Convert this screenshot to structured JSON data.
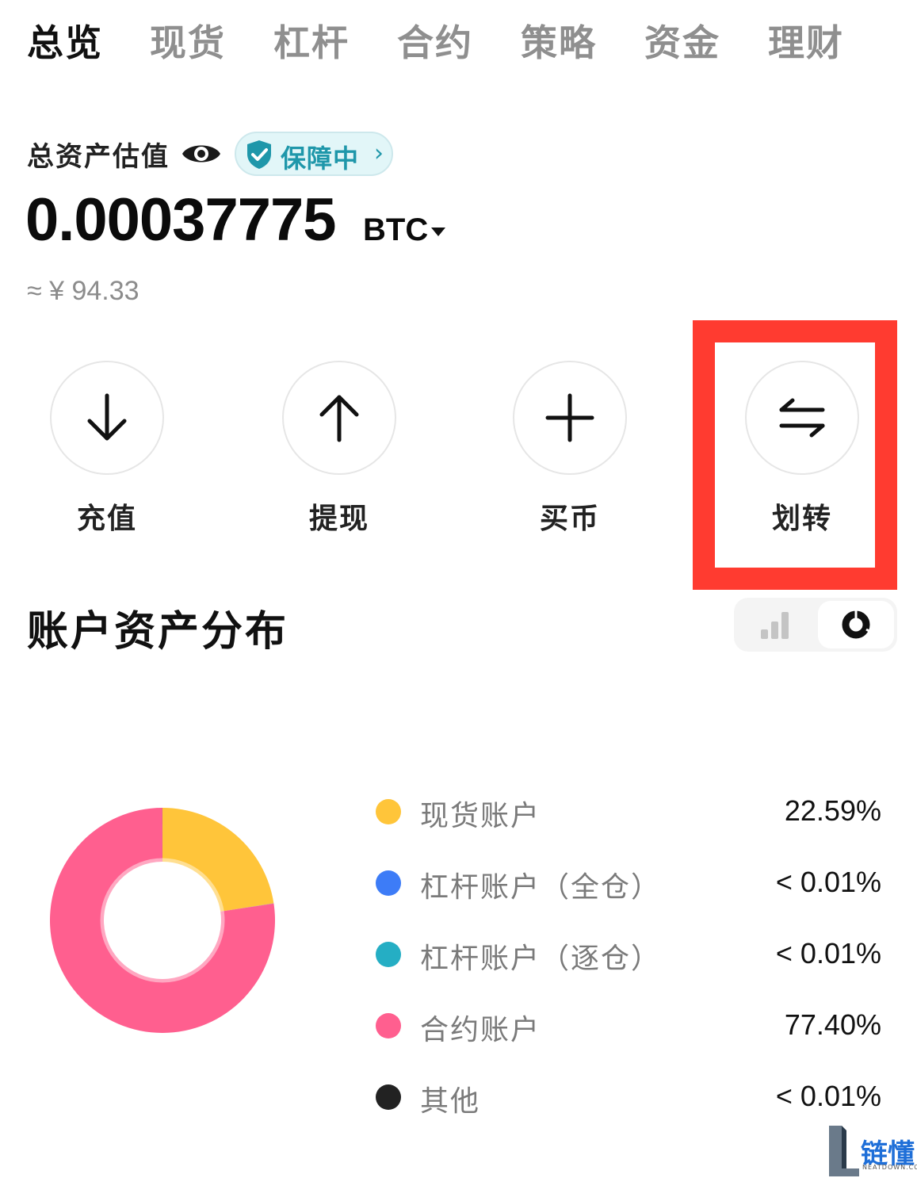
{
  "tabs": [
    {
      "label": "总览",
      "active": true
    },
    {
      "label": "现货",
      "active": false
    },
    {
      "label": "杠杆",
      "active": false
    },
    {
      "label": "合约",
      "active": false
    },
    {
      "label": "策略",
      "active": false
    },
    {
      "label": "资金",
      "active": false
    },
    {
      "label": "理财",
      "active": false
    }
  ],
  "asset": {
    "label": "总资产估值",
    "visibility_icon": "eye-icon",
    "badge": {
      "label": "保障中",
      "chevron": "›",
      "icon": "shield-check-icon"
    },
    "amount": "0.00037775",
    "unit": "BTC",
    "unit_caret_icon": "caret-down-icon",
    "approx": "≈ ¥ 94.33"
  },
  "actions": [
    {
      "label": "充值",
      "icon": "arrow-down-icon"
    },
    {
      "label": "提现",
      "icon": "arrow-up-icon"
    },
    {
      "label": "买币",
      "icon": "plus-icon"
    },
    {
      "label": "划转",
      "icon": "transfer-icon"
    }
  ],
  "distribution": {
    "title": "账户资产分布",
    "view_toggle": {
      "options": [
        "bar-chart-icon",
        "donut-chart-icon"
      ],
      "selected": "donut-chart-icon"
    }
  },
  "chart_data": {
    "type": "pie",
    "categories": [
      "现货账户",
      "杠杆账户（全仓）",
      "杠杆账户（逐仓）",
      "合约账户",
      "其他"
    ],
    "values": [
      22.59,
      0.01,
      0.01,
      77.4,
      0.01
    ],
    "value_labels": [
      "22.59%",
      "< 0.01%",
      "< 0.01%",
      "77.40%",
      "< 0.01%"
    ],
    "colors": [
      "#ffc53a",
      "#3d7cf7",
      "#25aec4",
      "#ff5f8f",
      "#222222"
    ],
    "donut": true,
    "legend_position": "right"
  },
  "watermark": {
    "text": "链懂",
    "sub": "NEATDOWN.COM"
  },
  "colors": {
    "highlight": "#ff3b30",
    "badge_text": "#1f97aa",
    "badge_bg": "#e2f6f8"
  }
}
